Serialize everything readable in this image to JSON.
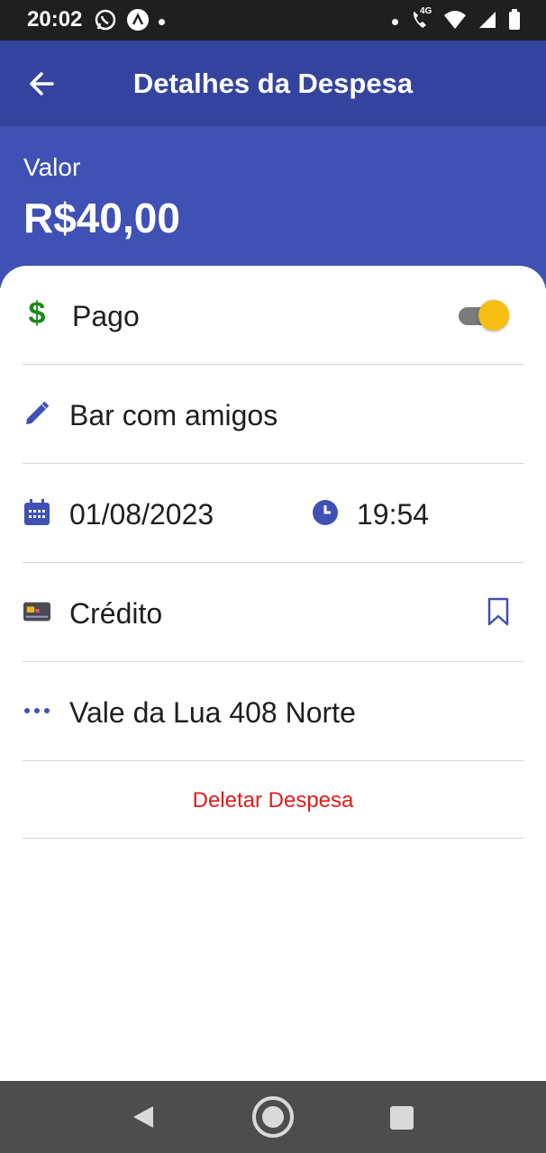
{
  "status_bar": {
    "time": "20:02",
    "network_label": "4G"
  },
  "app_bar": {
    "title": "Detalhes da Despesa"
  },
  "header": {
    "valor_label": "Valor",
    "valor_amount": "R$40,00"
  },
  "details": {
    "status_label": "Pago",
    "status_paid": true,
    "description": "Bar com amigos",
    "date": "01/08/2023",
    "time": "19:54",
    "payment_method": "Crédito",
    "location": "Vale da Lua 408 Norte",
    "delete_label": "Deletar Despesa"
  },
  "colors": {
    "app_bar": "#34449e",
    "header": "#3f51b5",
    "accent_icon": "#3f51b5",
    "money_icon": "#1a8a1a",
    "toggle_thumb": "#f7bd12",
    "delete_text": "#e01b1b"
  },
  "icons": {
    "back": "arrow-left-icon",
    "status": "dollar-icon",
    "description": "pencil-icon",
    "date": "calendar-icon",
    "time": "clock-icon",
    "payment": "credit-card-icon",
    "payment_action": "bookmark-icon",
    "location": "more-dots-icon"
  }
}
